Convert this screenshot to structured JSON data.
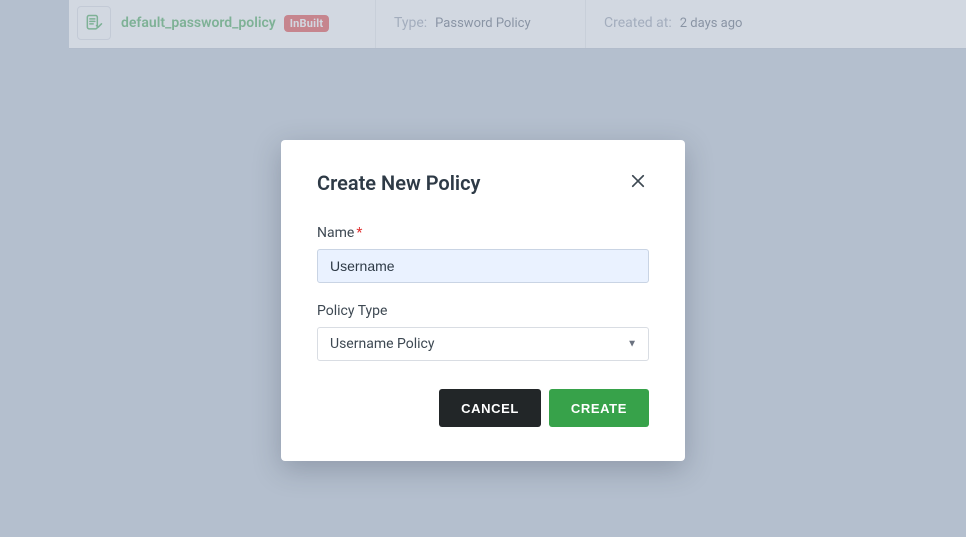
{
  "row": {
    "name": "default_password_policy",
    "badge": "InBuilt",
    "typeLabel": "Type:",
    "typeValue": "Password Policy",
    "createdLabel": "Created at:",
    "createdValue": "2 days ago"
  },
  "modal": {
    "title": "Create New Policy",
    "nameLabel": "Name",
    "nameRequiredMark": "*",
    "nameValue": "Username",
    "policyTypeLabel": "Policy Type",
    "policyTypeValue": "Username Policy",
    "cancel": "CANCEL",
    "create": "CREATE"
  }
}
